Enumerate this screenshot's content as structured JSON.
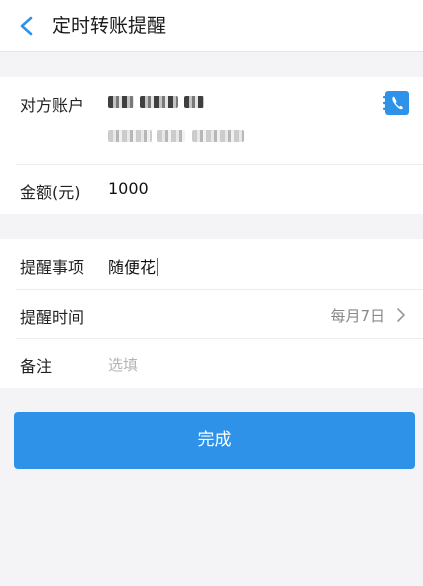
{
  "header": {
    "title": "定时转账提醒",
    "back_icon": "chevron-left-icon"
  },
  "account": {
    "label": "对方账户",
    "contact_icon": "phone-book-icon",
    "accent_color": "#2e93e8"
  },
  "amount": {
    "label": "金额(元)",
    "value": "1000"
  },
  "reminder": {
    "label": "提醒事项",
    "value": "随便花"
  },
  "time": {
    "label": "提醒时间",
    "value": "每月7日",
    "chevron_icon": "chevron-right-icon"
  },
  "note": {
    "label": "备注",
    "placeholder": "选填"
  },
  "actions": {
    "done_label": "完成",
    "button_color": "#2e93e8"
  }
}
